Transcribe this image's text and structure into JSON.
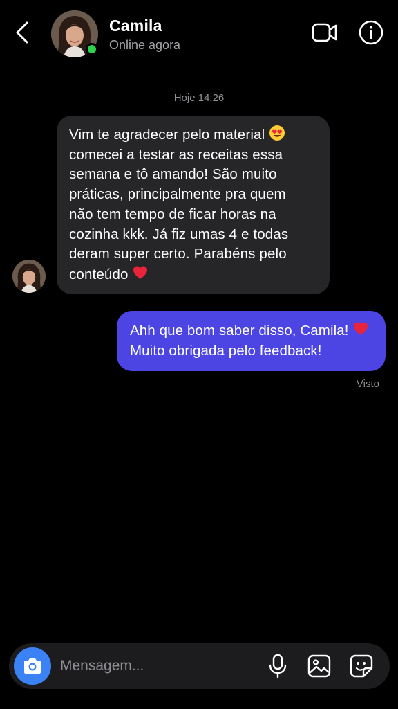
{
  "header": {
    "contact_name": "Camila",
    "status": "Online agora",
    "back_icon": "chevron-left-icon",
    "video_icon": "video-camera-icon",
    "info_icon": "info-icon",
    "online_color": "#2bd24a"
  },
  "conversation": {
    "timestamp": "Hoje 14:26",
    "messages": [
      {
        "direction": "incoming",
        "lines": [
          "Vim te agradecer pelo material",
          "comecei a testar as receitas essa",
          "semana e tô amando! São muito",
          "práticas, principalmente pra quem",
          "não tem tempo de ficar horas na",
          "cozinha kkk. Já fiz umas 4 e todas",
          "deram super certo. Parabéns pelo",
          "conteúdo"
        ],
        "emojis": [
          "heart-eyes-emoji",
          "red-heart-emoji"
        ],
        "bubble_color": "#262628"
      },
      {
        "direction": "outgoing",
        "lines": [
          "Ahh que bom saber disso, Camila!",
          "Muito obrigada pelo feedback!"
        ],
        "emojis": [
          "red-heart-emoji"
        ],
        "bubble_color": "#4c45e4"
      }
    ],
    "seen_label": "Visto"
  },
  "composer": {
    "placeholder": "Mensagem...",
    "camera_icon": "camera-icon",
    "mic_icon": "microphone-icon",
    "gallery_icon": "image-icon",
    "sticker_icon": "sticker-icon",
    "camera_color": "#3b82f6"
  }
}
